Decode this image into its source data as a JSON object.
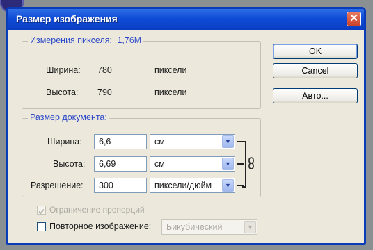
{
  "dialog": {
    "title": "Размер изображения",
    "close_icon": "close-icon"
  },
  "pixel_dimensions": {
    "legend": "Измерения пикселя:",
    "size": "1,76M",
    "width_label": "Ширина:",
    "width_value": "780",
    "width_unit": "пиксели",
    "height_label": "Высота:",
    "height_value": "790",
    "height_unit": "пиксели"
  },
  "document_size": {
    "legend": "Размер документа:",
    "width_label": "Ширина:",
    "width_value": "6,6",
    "width_unit": "см",
    "height_label": "Высота:",
    "height_value": "6,69",
    "height_unit": "см",
    "resolution_label": "Разрешение:",
    "resolution_value": "300",
    "resolution_unit": "пиксели/дюйм",
    "link_icon": "chain-link-icon"
  },
  "buttons": {
    "ok": "OK",
    "cancel": "Cancel",
    "auto": "Авто..."
  },
  "options": {
    "constrain_label": "Ограничение пропорций",
    "constrain_checked": true,
    "constrain_disabled": true,
    "resample_label": "Повторное изображение:",
    "resample_checked": false,
    "resample_method": "Бикубический"
  }
}
